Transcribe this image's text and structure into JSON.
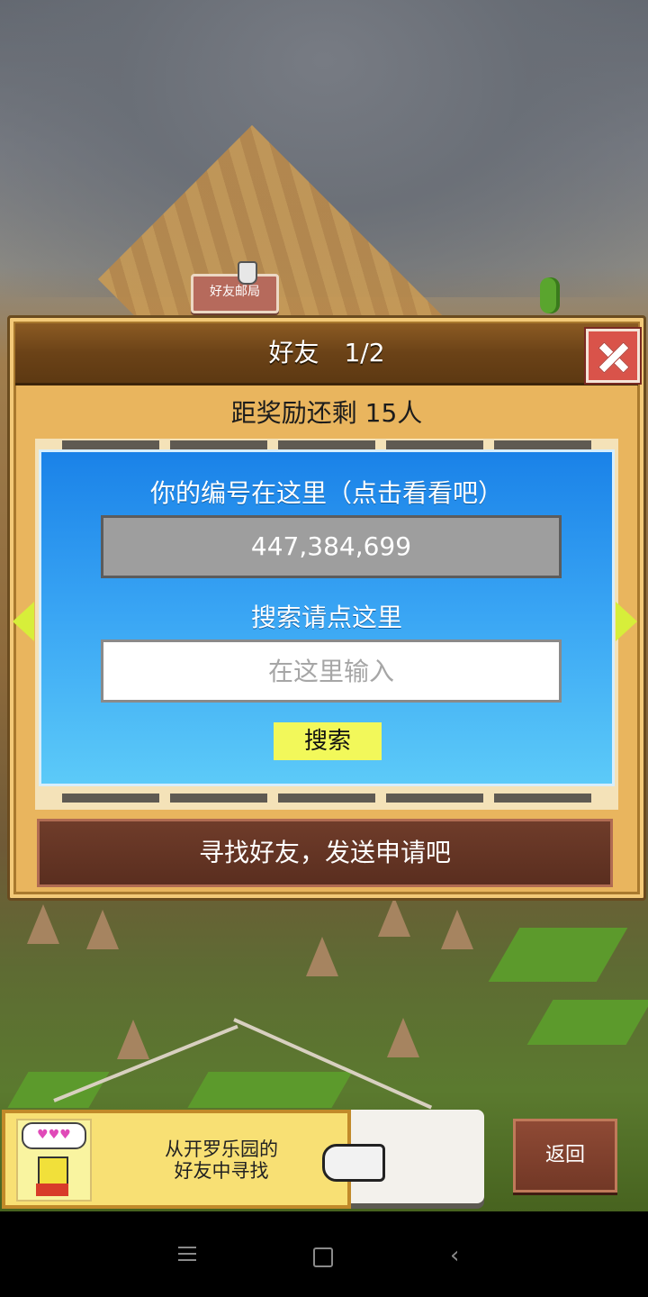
{
  "map": {
    "post_office_label": "好友邮局"
  },
  "dialog": {
    "title": "好友　1/2",
    "reward_text": "距奖励还剩 15人",
    "id_label": "你的编号在这里（点击看看吧）",
    "id_value": "447,384,699",
    "search_label": "搜索请点这里",
    "search_placeholder": "在这里输入",
    "search_button": "搜索",
    "find_button": "寻找好友，发送申请吧"
  },
  "banner": {
    "text_line1": "从开罗乐园的",
    "text_line2": "好友中寻找",
    "hearts": "♥♥♥"
  },
  "back_button": "返回",
  "colors": {
    "panel_blue": "#1a82e8",
    "dialog_gold": "#e9b55e",
    "close_red": "#d9534a",
    "search_yellow": "#f2f85a",
    "find_brown": "#6f3c2a"
  }
}
